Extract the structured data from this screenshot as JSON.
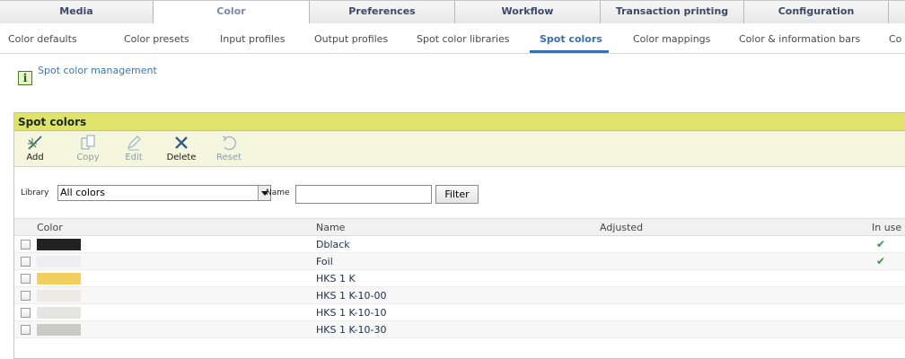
{
  "top_tabs": [
    {
      "label": "Media",
      "active": false
    },
    {
      "label": "Color",
      "active": true
    },
    {
      "label": "Preferences",
      "active": false
    },
    {
      "label": "Workflow",
      "active": false
    },
    {
      "label": "Transaction printing",
      "active": false
    },
    {
      "label": "Configuration",
      "active": false
    }
  ],
  "sub_tabs": [
    {
      "label": "Color defaults",
      "active": false
    },
    {
      "label": "Color presets",
      "active": false
    },
    {
      "label": "Input profiles",
      "active": false
    },
    {
      "label": "Output profiles",
      "active": false
    },
    {
      "label": "Spot color libraries",
      "active": false
    },
    {
      "label": "Spot colors",
      "active": true
    },
    {
      "label": "Color mappings",
      "active": false
    },
    {
      "label": "Color & information bars",
      "active": false
    },
    {
      "label": "Co",
      "active": false
    }
  ],
  "info": {
    "link": "Spot color management",
    "icon": "info-icon"
  },
  "panel": {
    "title": "Spot colors"
  },
  "toolbar": {
    "add": "Add",
    "copy": "Copy",
    "edit": "Edit",
    "delete": "Delete",
    "reset": "Reset"
  },
  "filter": {
    "library_label": "Library",
    "library_value": "All colors",
    "name_label": "Name",
    "name_value": "",
    "filter_button": "Filter"
  },
  "table": {
    "headers": {
      "color": "Color",
      "name": "Name",
      "adjusted": "Adjusted",
      "in_use": "In use"
    },
    "rows": [
      {
        "name": "Dblack",
        "swatch": "#222222",
        "in_use": "✔"
      },
      {
        "name": "Foil",
        "swatch": "#eeeef2",
        "in_use": "✔"
      },
      {
        "name": "HKS 1 K",
        "swatch": "#f2cf5f",
        "in_use": ""
      },
      {
        "name": "HKS 1 K-10-00",
        "swatch": "#ecebe6",
        "in_use": ""
      },
      {
        "name": "HKS 1 K-10-10",
        "swatch": "#e4e4e2",
        "in_use": ""
      },
      {
        "name": "HKS 1 K-10-30",
        "swatch": "#cacac8",
        "in_use": ""
      }
    ]
  },
  "colors": {
    "accent": "#3a6fb0",
    "panel_header": "#dfe36a",
    "toolbar_bg": "#f4f7dd",
    "check_green": "#2e9a3a"
  }
}
